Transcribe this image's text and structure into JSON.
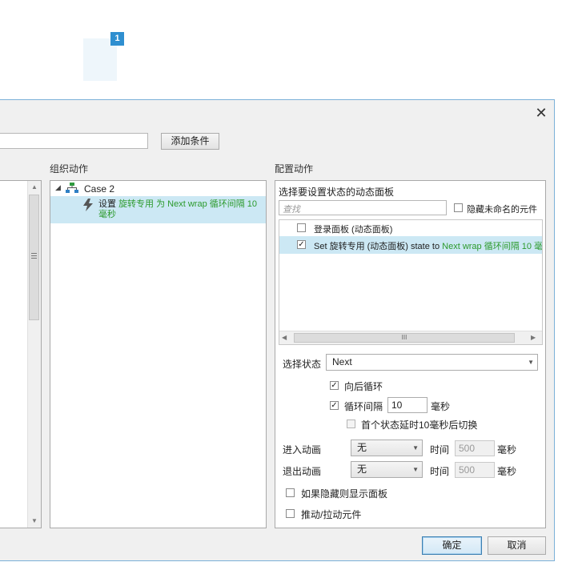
{
  "canvas": {
    "badge": "1"
  },
  "dialog": {
    "add_condition_label": "添加条件",
    "organize_actions_label": "组织动作",
    "configure_actions_label": "配置动作",
    "case_label": "Case 2",
    "action": {
      "prefix": "设置 ",
      "highlight": "旋转专用 为 Next wrap 循环间隔 10 毫秒"
    },
    "config": {
      "select_panel_title": "选择要设置状态的动态面板",
      "search_placeholder": "查找",
      "hide_unnamed_label": "隐藏未命名的元件",
      "panels": [
        {
          "label": "登录面板 (动态面板)",
          "checked": false
        },
        {
          "label_prefix": "Set 旋转专用 (动态面板) state to ",
          "label_highlight": "Next wrap 循环间隔 10 毫",
          "checked": true
        }
      ],
      "hscroll_grip": "III",
      "select_state_label": "选择状态",
      "select_state_value": "Next",
      "wrap_label": "向后循环",
      "repeat_label": "循环间隔",
      "repeat_value": "10",
      "ms_unit": "毫秒",
      "first_state_delay_label": "首个状态延时10毫秒后切换",
      "enter_anim_label": "进入动画",
      "enter_anim_value": "无",
      "exit_anim_label": "退出动画",
      "exit_anim_value": "无",
      "time_label": "时间",
      "time_value": "500",
      "show_if_hidden_label": "如果隐藏则显示面板",
      "push_pull_label": "推动/拉动元件"
    },
    "ok_label": "确定",
    "cancel_label": "取消"
  }
}
